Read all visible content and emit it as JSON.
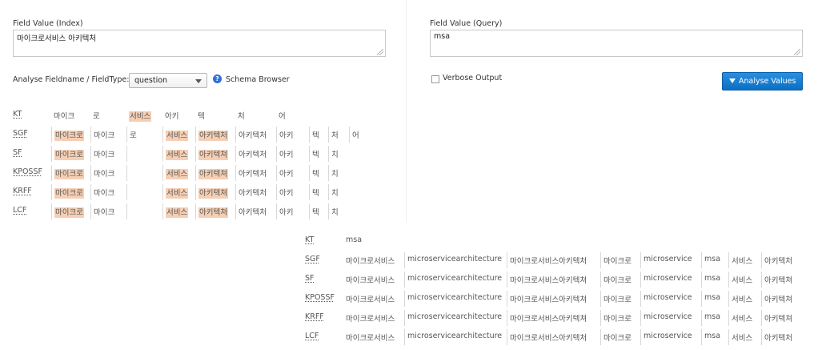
{
  "index_pane": {
    "field_value_label": "Field Value (Index)",
    "field_value": "마이크로서비스 아키텍처",
    "fieldname_label": "Analyse Fieldname / FieldType:",
    "fieldtype_selected": "question",
    "schema_browser_label": "Schema Browser"
  },
  "query_pane": {
    "field_value_label": "Field Value (Query)",
    "field_value": "msa",
    "verbose_label": "Verbose Output",
    "analyse_button": "Analyse Values"
  },
  "colors": {
    "highlight": "#f5cfb4",
    "button": "#1a7fd4",
    "help": "#2f6fd6"
  },
  "index_analysis": [
    {
      "name": "KT",
      "tokens": [
        {
          "text": "마이크",
          "hl": false
        },
        {
          "text": "로",
          "hl": false
        },
        {
          "text": "서비스",
          "hl": true
        },
        {
          "text": "아키",
          "hl": false
        },
        {
          "text": "텍",
          "hl": false
        },
        {
          "text": "처",
          "hl": false
        },
        {
          "text": "어",
          "hl": false
        }
      ]
    },
    {
      "name": "SGF",
      "tokens": [
        {
          "text": "마이크로",
          "hl": true
        },
        {
          "text": "마이크",
          "hl": false
        },
        {
          "text": "로",
          "hl": false
        },
        {
          "text": "서비스",
          "hl": true
        },
        {
          "text": "아키텍처",
          "hl": true
        },
        {
          "text": "아키텍처",
          "hl": false
        },
        {
          "text": "아키",
          "hl": false
        },
        {
          "text": "텍",
          "hl": false
        },
        {
          "text": "처",
          "hl": false
        },
        {
          "text": "어",
          "hl": false
        }
      ]
    },
    {
      "name": "SF",
      "tokens": [
        {
          "text": "마이크로",
          "hl": true
        },
        {
          "text": "마이크",
          "hl": false
        },
        {
          "text": "",
          "hl": false
        },
        {
          "text": "서비스",
          "hl": true
        },
        {
          "text": "아키텍쳐",
          "hl": true
        },
        {
          "text": "아키텍처",
          "hl": false
        },
        {
          "text": "아키",
          "hl": false
        },
        {
          "text": "텍",
          "hl": false
        },
        {
          "text": "치",
          "hl": false
        }
      ]
    },
    {
      "name": "KPOSSF",
      "tokens": [
        {
          "text": "마이크로",
          "hl": true
        },
        {
          "text": "마이크",
          "hl": false
        },
        {
          "text": "",
          "hl": false
        },
        {
          "text": "서비스",
          "hl": true
        },
        {
          "text": "아키텍쳐",
          "hl": true
        },
        {
          "text": "아키텍처",
          "hl": false
        },
        {
          "text": "아키",
          "hl": false
        },
        {
          "text": "텍",
          "hl": false
        },
        {
          "text": "치",
          "hl": false
        }
      ]
    },
    {
      "name": "KRFF",
      "tokens": [
        {
          "text": "마이크로",
          "hl": true
        },
        {
          "text": "마이크",
          "hl": false
        },
        {
          "text": "",
          "hl": false
        },
        {
          "text": "서비스",
          "hl": true
        },
        {
          "text": "아키텍쳐",
          "hl": true
        },
        {
          "text": "아키텍처",
          "hl": false
        },
        {
          "text": "아키",
          "hl": false
        },
        {
          "text": "텍",
          "hl": false
        },
        {
          "text": "치",
          "hl": false
        }
      ]
    },
    {
      "name": "LCF",
      "tokens": [
        {
          "text": "마이크로",
          "hl": true
        },
        {
          "text": "마이크",
          "hl": false
        },
        {
          "text": "",
          "hl": false
        },
        {
          "text": "서비스",
          "hl": true
        },
        {
          "text": "아키텍쳐",
          "hl": true
        },
        {
          "text": "아키텍처",
          "hl": false
        },
        {
          "text": "아키",
          "hl": false
        },
        {
          "text": "텍",
          "hl": false
        },
        {
          "text": "치",
          "hl": false
        }
      ]
    }
  ],
  "query_analysis": [
    {
      "name": "KT",
      "tokens": [
        "msa"
      ]
    },
    {
      "name": "SGF",
      "tokens": [
        "마이크로서비스",
        "microservicearchitecture",
        "마이크로서비스아키텍처",
        "마이크로",
        "microservice",
        "msa",
        "서비스",
        "아키텍처"
      ]
    },
    {
      "name": "SF",
      "tokens": [
        "마이크로서비스",
        "microservicearchitecture",
        "마이크로서비스아키텍쳐",
        "마이크로",
        "microservice",
        "msa",
        "서비스",
        "아키텍쳐"
      ]
    },
    {
      "name": "KPOSSF",
      "tokens": [
        "마이크로서비스",
        "microservicearchitecture",
        "마이크로서비스아키텍쳐",
        "마이크로",
        "microservice",
        "msa",
        "서비스",
        "아키텍쳐"
      ]
    },
    {
      "name": "KRFF",
      "tokens": [
        "마이크로서비스",
        "microservicearchitecture",
        "마이크로서비스아키텍쳐",
        "마이크로",
        "microservice",
        "msa",
        "서비스",
        "아키텍쳐"
      ]
    },
    {
      "name": "LCF",
      "tokens": [
        "마이크로서비스",
        "microservicearchitecture",
        "마이크로서비스아키텍처",
        "마이크로",
        "microservice",
        "msa",
        "서비스",
        "아키텍처"
      ]
    }
  ]
}
